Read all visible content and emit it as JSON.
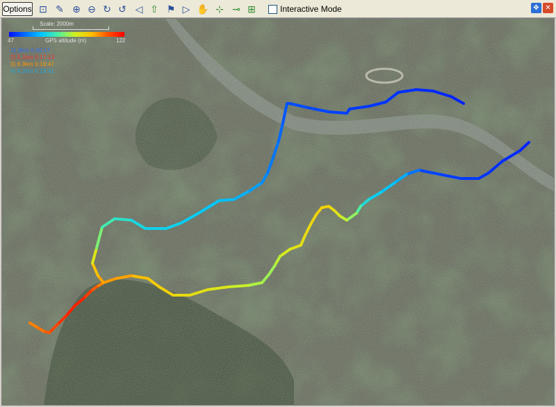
{
  "toolbar": {
    "options_label": "Options",
    "tools": [
      {
        "name": "zoom-area-icon",
        "glyph": "⊡"
      },
      {
        "name": "draw-icon",
        "glyph": "✎"
      },
      {
        "name": "zoom-in-icon",
        "glyph": "⊕"
      },
      {
        "name": "zoom-out-icon",
        "glyph": "⊖"
      },
      {
        "name": "rotate-cw-icon",
        "glyph": "↻"
      },
      {
        "name": "rotate-ccw-icon",
        "glyph": "↺"
      },
      {
        "name": "play-back-icon",
        "glyph": "◁"
      },
      {
        "name": "up-arrow-icon",
        "glyph": "⇧"
      },
      {
        "name": "flag-down-icon",
        "glyph": "⚑"
      },
      {
        "name": "play-forward-icon",
        "glyph": "▷"
      },
      {
        "name": "pan-hand-icon",
        "glyph": "✋"
      },
      {
        "name": "add-node-icon",
        "glyph": "⊹"
      },
      {
        "name": "remove-node-icon",
        "glyph": "⊸"
      },
      {
        "name": "add-route-icon",
        "glyph": "⊞"
      }
    ],
    "interactive_mode_label": "Interactive Mode",
    "interactive_mode_checked": false
  },
  "window_buttons": [
    {
      "name": "move-icon",
      "glyph": "✥",
      "color": "#2c6fd6"
    },
    {
      "name": "close-icon",
      "glyph": "✕",
      "color": "#d84b2a"
    }
  ],
  "legend": {
    "scale_label": "Scale: 2000m",
    "ramp_min": "47",
    "ramp_title": "GPS altitude (m)",
    "ramp_max": "122",
    "entries": [
      {
        "text": "11.8km  0:40:17",
        "color": "#2f6fff"
      },
      {
        "text": "2) 5.1km  0:17:13",
        "color": "#ff3030"
      },
      {
        "text": "3) 6.9km  0:19:47",
        "color": "#ff9a00"
      },
      {
        "text": "4) 8.2km  0:28:41",
        "color": "#20a8d8"
      }
    ]
  },
  "colors": {
    "track_low": "#0020ff",
    "track_high": "#ff0000",
    "map_base": "#4b5344"
  }
}
